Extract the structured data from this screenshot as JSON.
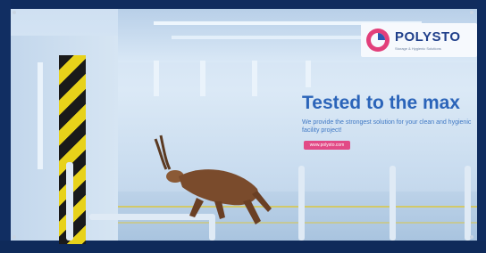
{
  "banner": {
    "brand": {
      "name": "POLYSTO",
      "tagline": "Storage & Hygienic Solutions"
    },
    "headline": "Tested to the max",
    "subline": "We provide the strongest solution for your clean and hygienic facility project!",
    "cta": "www.polysto.com"
  },
  "colors": {
    "brand_blue": "#2b64b9",
    "cta_pink": "#e24a86",
    "frame_navy": "#0f2a5a",
    "hazard_yellow": "#e8d21a"
  },
  "icons": [
    "polysto-logo-icon"
  ]
}
